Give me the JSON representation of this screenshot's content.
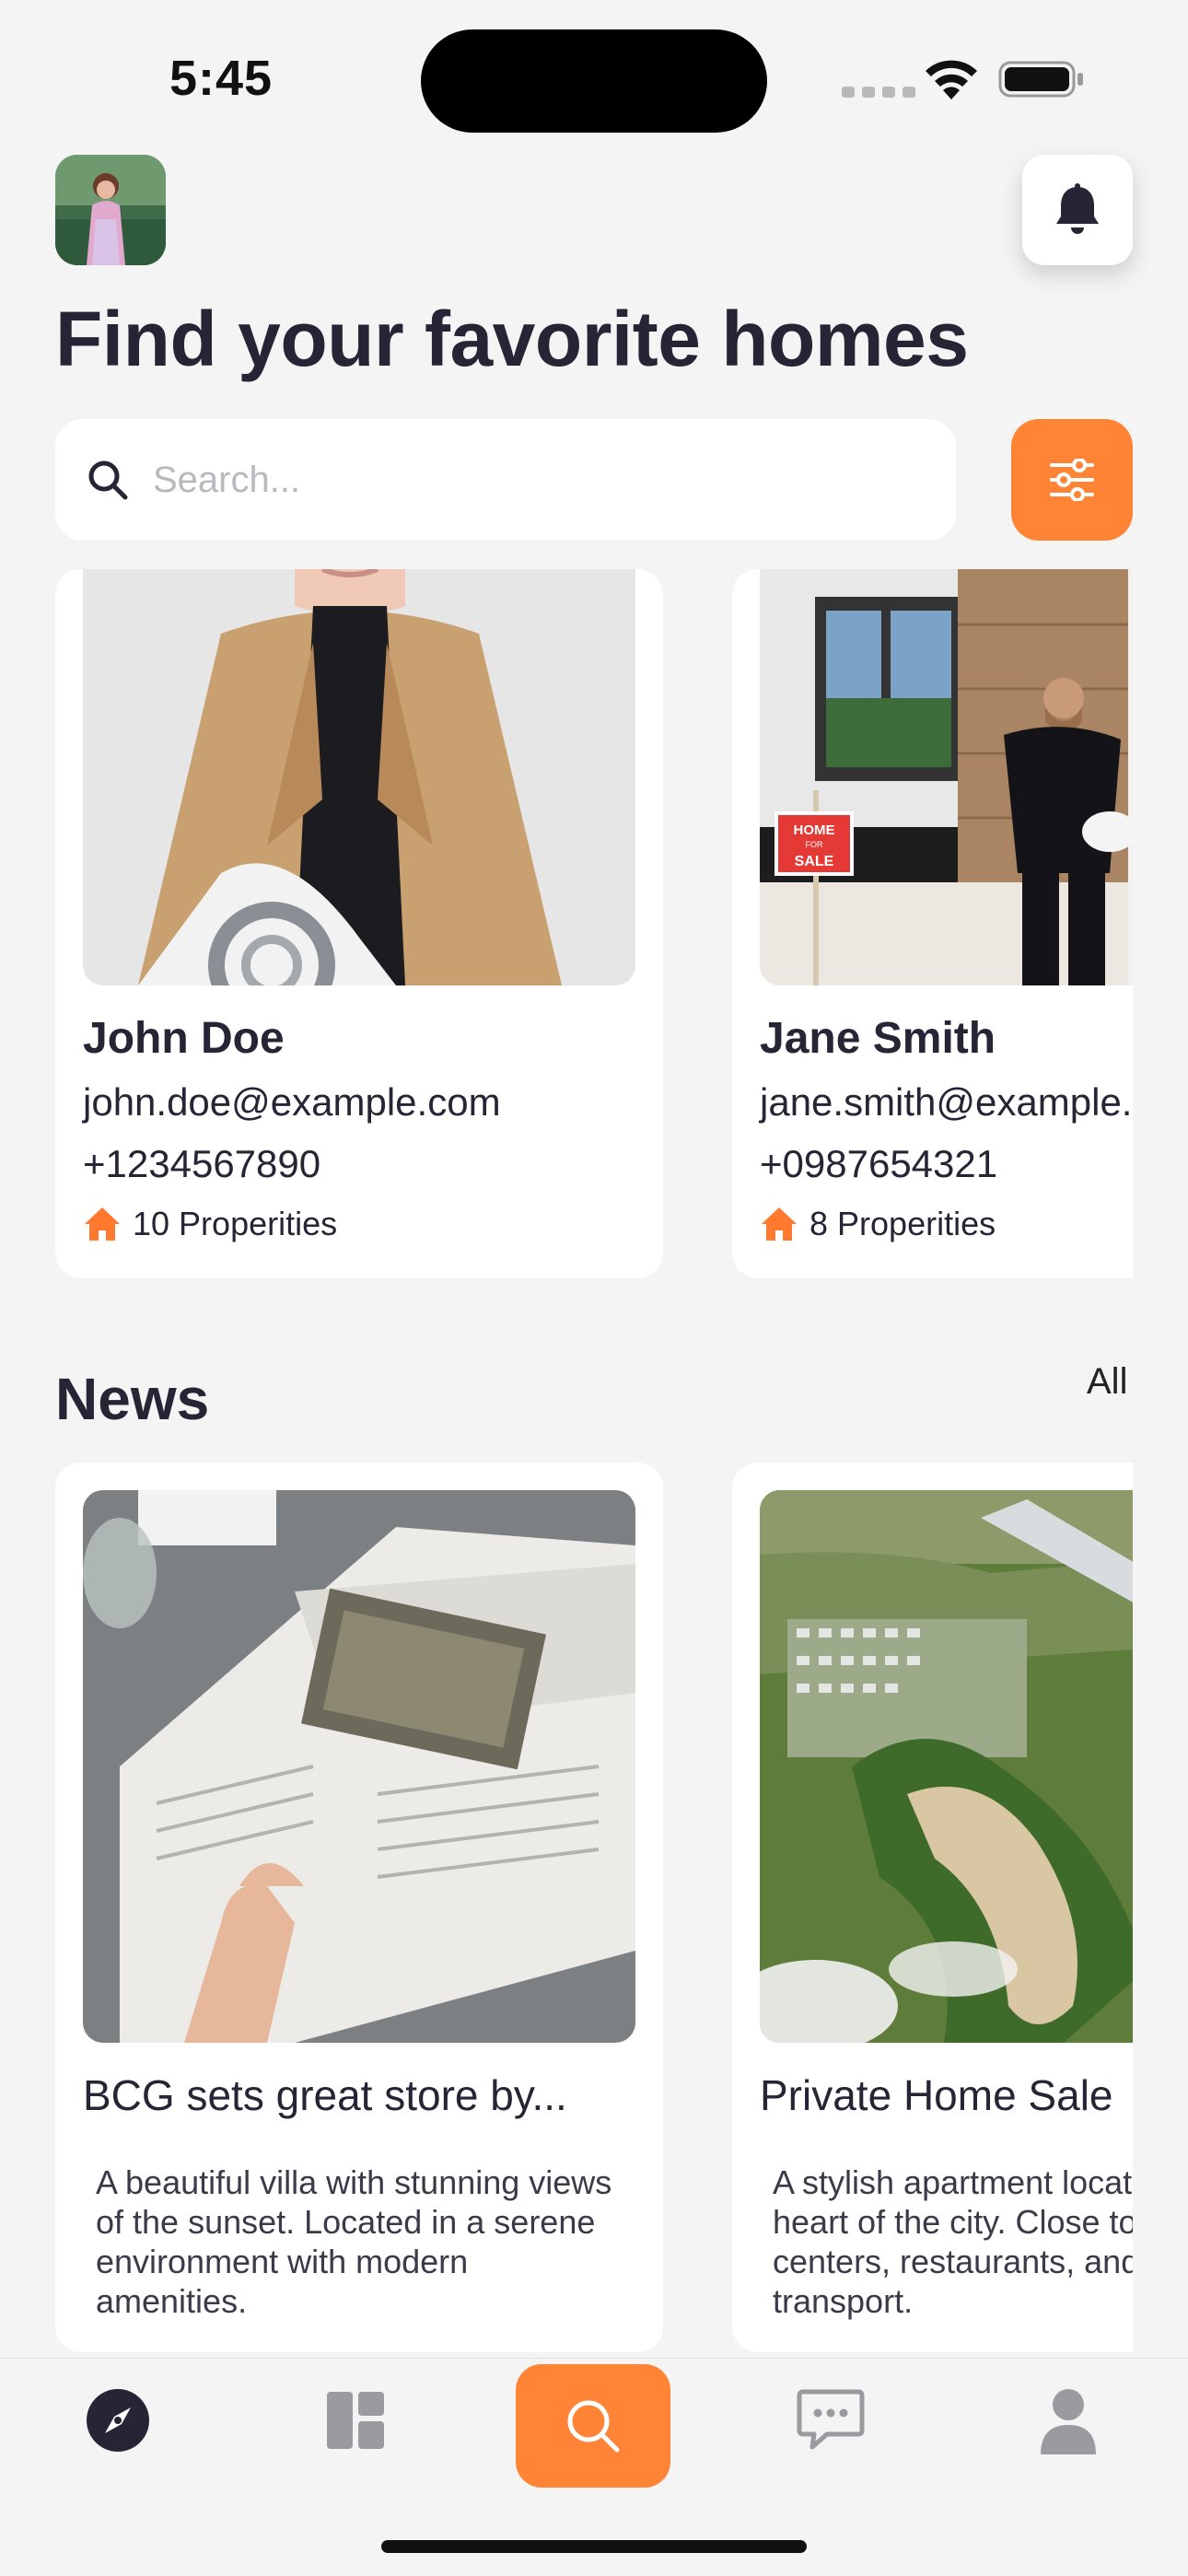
{
  "status_bar": {
    "time": "5:45"
  },
  "header": {
    "title": "Find your favorite homes"
  },
  "search": {
    "placeholder": "Search..."
  },
  "agents": [
    {
      "name": "John Doe",
      "email": "john.doe@example.com",
      "phone": "+1234567890",
      "properties": "10 Properities"
    },
    {
      "name": "Jane Smith",
      "email": "jane.smith@example.com",
      "phone": "+0987654321",
      "properties": "8 Properities"
    }
  ],
  "news": {
    "title": "News",
    "all_label": "All",
    "items": [
      {
        "headline": "BCG sets great store by...",
        "description": "A beautiful villa with stunning views of the sunset. Located in a serene environment with modern amenities."
      },
      {
        "headline": "Private Home Sale",
        "description": "A stylish apartment located in the heart of the city. Close to shopping centers, restaurants, and public transport."
      }
    ]
  },
  "photo_sign": {
    "line1": "HOME",
    "line2": "FOR",
    "line3": "SALE"
  },
  "colors": {
    "accent": "#ff8435",
    "text": "#252535",
    "background": "#f4f4f4"
  },
  "tabbar": [
    "compass-icon",
    "dashboard-icon",
    "search-icon",
    "chat-icon",
    "profile-icon"
  ]
}
